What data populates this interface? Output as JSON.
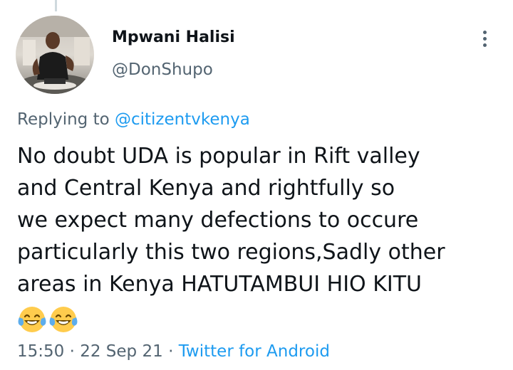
{
  "author": {
    "display_name": "Mpwani Halisi",
    "handle": "@DonShupo"
  },
  "reply": {
    "prefix": "Replying to",
    "mention": "@citizentvkenya"
  },
  "tweet": {
    "lines": [
      "No doubt UDA is popular in Rift valley",
      "and Central Kenya and rightfully so",
      "we expect many defections to occure",
      "particularly this two regions,Sadly other",
      "areas in Kenya HATUTAMBUI HIO KITU"
    ],
    "emojis": [
      "face-with-tears-of-joy-icon",
      "face-with-tears-of-joy-icon"
    ]
  },
  "meta": {
    "time": "15:50",
    "separator": "·",
    "date": "22 Sep 21",
    "source": "Twitter for Android"
  },
  "colors": {
    "text": "#0f1419",
    "secondary": "#536471",
    "link": "#1d9bf0",
    "thread_line": "#cfd9de"
  },
  "icons": {
    "more": "more-vertical-icon"
  }
}
